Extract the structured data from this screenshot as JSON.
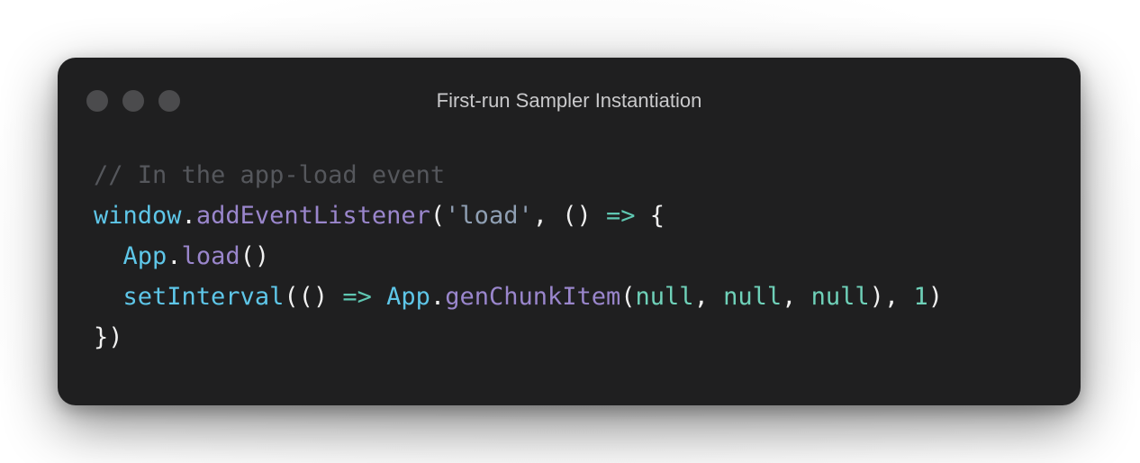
{
  "window": {
    "title": "First-run Sampler Instantiation",
    "controls": [
      "close-dot",
      "minimize-dot",
      "maximize-dot"
    ]
  },
  "code": {
    "line1": {
      "comment": "// In the app-load event"
    },
    "line2": {
      "obj": "window",
      "dot": ".",
      "method": "addEventListener",
      "open": "(",
      "string": "'load'",
      "sep": ", () ",
      "arrow": "=>",
      "brace": " {"
    },
    "line3": {
      "indent": "  ",
      "obj": "App",
      "dot": ".",
      "method": "load",
      "call": "()"
    },
    "line4": {
      "indent": "  ",
      "fn": "setInterval",
      "open": "(() ",
      "arrow": "=>",
      "space": " ",
      "obj": "App",
      "dot": ".",
      "method": "genChunkItem",
      "open2": "(",
      "arg1": "null",
      "comma1": ", ",
      "arg2": "null",
      "comma2": ", ",
      "arg3": "null",
      "close1": "), ",
      "num": "1",
      "close2": ")"
    },
    "line5": {
      "text": "})"
    }
  },
  "colors": {
    "background": "#1f1f20",
    "comment": "#55575c",
    "identifier": "#5ec6e8",
    "method": "#9a86cc",
    "string": "#8f9fb3",
    "arrow": "#5fc7b2",
    "literal": "#6fd1b9",
    "punctuation": "#f0f0f0"
  }
}
